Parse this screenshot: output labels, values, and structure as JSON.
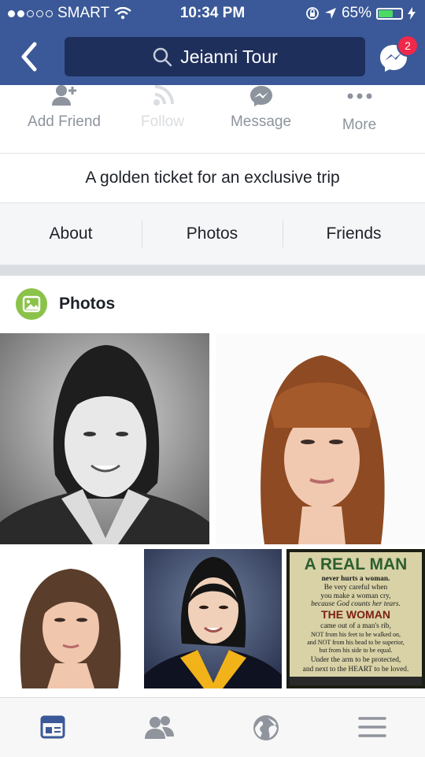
{
  "status_bar": {
    "carrier": "SMART",
    "time": "10:34 PM",
    "battery": "65%",
    "signal_bars": 2,
    "battery_level": 0.65
  },
  "nav": {
    "search_text": "Jeianni Tour",
    "messenger_badge": "2"
  },
  "actions": [
    {
      "label": "Add Friend",
      "icon": "add-friend-icon",
      "enabled": true
    },
    {
      "label": "Follow",
      "icon": "rss-icon",
      "enabled": false
    },
    {
      "label": "Message",
      "icon": "messenger-icon",
      "enabled": true
    },
    {
      "label": "More",
      "icon": "more-dots-icon",
      "enabled": true
    }
  ],
  "profile": {
    "subtitle": "A golden ticket for an exclusive trip"
  },
  "tabs": [
    "About",
    "Photos",
    "Friends"
  ],
  "photos_section": {
    "title": "Photos"
  },
  "quote_card": {
    "title": "A REAL MAN",
    "lines": [
      "never hurts a woman.",
      "Be very careful when",
      "you make a woman cry,",
      "because God counts her tears.",
      "THE WOMAN",
      "came out of a man's rib,",
      "NOT from his feet to be walked on,",
      "and NOT from his head to be superior,",
      "but from his side to be equal.",
      "Under the arm to be protected,",
      "and next to the HEART to be loved."
    ]
  },
  "bottom_bar": [
    "news-feed-icon",
    "friends-icon",
    "globe-icon",
    "menu-icon"
  ],
  "colors": {
    "brand": "#3b5998",
    "badge": "#f02849",
    "photos_icon": "#8bc34a"
  }
}
